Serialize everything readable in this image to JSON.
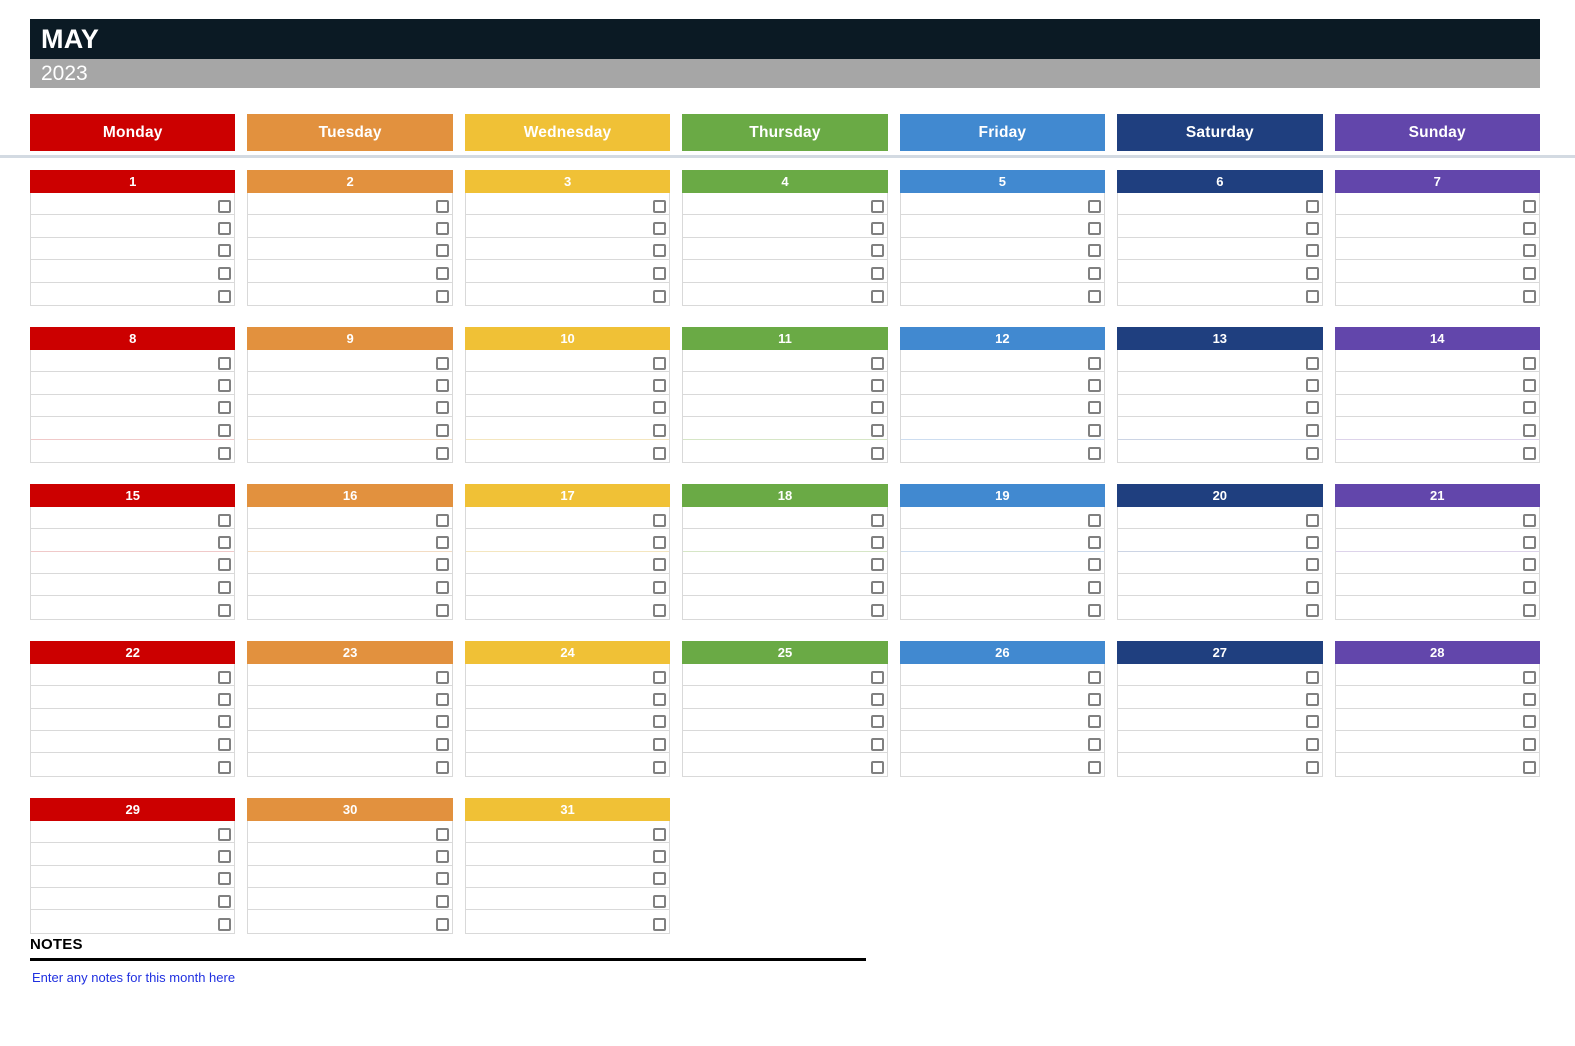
{
  "header": {
    "month": "MAY",
    "year": "2023",
    "month_bar_color": "#0b1a24",
    "year_bar_color": "#a6a6a6"
  },
  "weekdays": [
    {
      "label": "Monday",
      "color": "#cc0000",
      "key": "red"
    },
    {
      "label": "Tuesday",
      "color": "#e2913e",
      "key": "orange"
    },
    {
      "label": "Wednesday",
      "color": "#f0c136",
      "key": "yellow"
    },
    {
      "label": "Thursday",
      "color": "#6aaa45",
      "key": "green"
    },
    {
      "label": "Friday",
      "color": "#4189d0",
      "key": "blue"
    },
    {
      "label": "Saturday",
      "color": "#1f3f7f",
      "key": "navy"
    },
    {
      "label": "Sunday",
      "color": "#6246ab",
      "key": "purple"
    }
  ],
  "weeks": [
    {
      "days": [
        {
          "date": "1",
          "tasks": [
            "",
            "",
            "",
            "",
            ""
          ]
        },
        {
          "date": "2",
          "tasks": [
            "",
            "",
            "",
            "",
            ""
          ]
        },
        {
          "date": "3",
          "tasks": [
            "",
            "",
            "",
            "",
            ""
          ]
        },
        {
          "date": "4",
          "tasks": [
            "",
            "",
            "",
            "",
            ""
          ]
        },
        {
          "date": "5",
          "tasks": [
            "",
            "",
            "",
            "",
            ""
          ]
        },
        {
          "date": "6",
          "tasks": [
            "",
            "",
            "",
            "",
            ""
          ]
        },
        {
          "date": "7",
          "tasks": [
            "",
            "",
            "",
            "",
            ""
          ]
        }
      ]
    },
    {
      "days": [
        {
          "date": "8",
          "tasks": [
            "",
            "",
            "",
            "",
            ""
          ]
        },
        {
          "date": "9",
          "tasks": [
            "",
            "",
            "",
            "",
            ""
          ]
        },
        {
          "date": "10",
          "tasks": [
            "",
            "",
            "",
            "",
            ""
          ]
        },
        {
          "date": "11",
          "tasks": [
            "",
            "",
            "",
            "",
            ""
          ]
        },
        {
          "date": "12",
          "tasks": [
            "",
            "",
            "",
            "",
            ""
          ]
        },
        {
          "date": "13",
          "tasks": [
            "",
            "",
            "",
            "",
            ""
          ]
        },
        {
          "date": "14",
          "tasks": [
            "",
            "",
            "",
            "",
            ""
          ]
        }
      ]
    },
    {
      "days": [
        {
          "date": "15",
          "tasks": [
            "",
            "",
            "",
            "",
            ""
          ]
        },
        {
          "date": "16",
          "tasks": [
            "",
            "",
            "",
            "",
            ""
          ]
        },
        {
          "date": "17",
          "tasks": [
            "",
            "",
            "",
            "",
            ""
          ]
        },
        {
          "date": "18",
          "tasks": [
            "",
            "",
            "",
            "",
            ""
          ]
        },
        {
          "date": "19",
          "tasks": [
            "",
            "",
            "",
            "",
            ""
          ]
        },
        {
          "date": "20",
          "tasks": [
            "",
            "",
            "",
            "",
            ""
          ]
        },
        {
          "date": "21",
          "tasks": [
            "",
            "",
            "",
            "",
            ""
          ]
        }
      ]
    },
    {
      "days": [
        {
          "date": "22",
          "tasks": [
            "",
            "",
            "",
            "",
            ""
          ]
        },
        {
          "date": "23",
          "tasks": [
            "",
            "",
            "",
            "",
            ""
          ]
        },
        {
          "date": "24",
          "tasks": [
            "",
            "",
            "",
            "",
            ""
          ]
        },
        {
          "date": "25",
          "tasks": [
            "",
            "",
            "",
            "",
            ""
          ]
        },
        {
          "date": "26",
          "tasks": [
            "",
            "",
            "",
            "",
            ""
          ]
        },
        {
          "date": "27",
          "tasks": [
            "",
            "",
            "",
            "",
            ""
          ]
        },
        {
          "date": "28",
          "tasks": [
            "",
            "",
            "",
            "",
            ""
          ]
        }
      ]
    },
    {
      "days": [
        {
          "date": "29",
          "tasks": [
            "",
            "",
            "",
            "",
            ""
          ]
        },
        {
          "date": "30",
          "tasks": [
            "",
            "",
            "",
            "",
            ""
          ]
        },
        {
          "date": "31",
          "tasks": [
            "",
            "",
            "",
            "",
            ""
          ]
        },
        {
          "date": "",
          "tasks": []
        },
        {
          "date": "",
          "tasks": []
        },
        {
          "date": "",
          "tasks": []
        },
        {
          "date": "",
          "tasks": []
        }
      ]
    }
  ],
  "notes": {
    "title": "NOTES",
    "placeholder": "Enter any notes for this month here",
    "placeholder_color": "#2030e0"
  }
}
